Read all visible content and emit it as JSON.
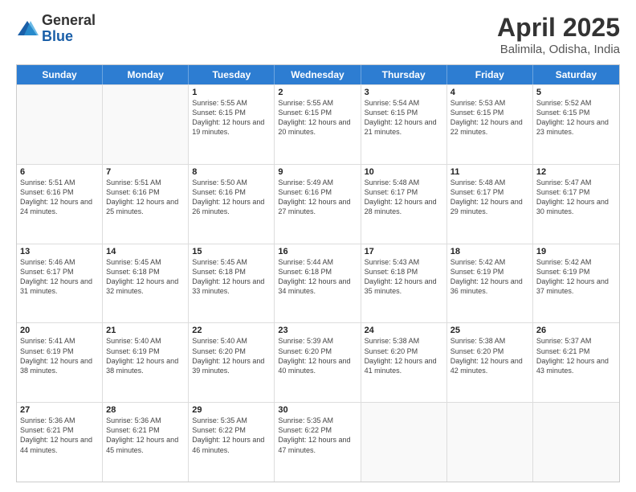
{
  "logo": {
    "general": "General",
    "blue": "Blue"
  },
  "title": {
    "month": "April 2025",
    "location": "Balimila, Odisha, India"
  },
  "header_days": [
    "Sunday",
    "Monday",
    "Tuesday",
    "Wednesday",
    "Thursday",
    "Friday",
    "Saturday"
  ],
  "weeks": [
    [
      {
        "day": "",
        "info": ""
      },
      {
        "day": "",
        "info": ""
      },
      {
        "day": "1",
        "info": "Sunrise: 5:55 AM\nSunset: 6:15 PM\nDaylight: 12 hours and 19 minutes."
      },
      {
        "day": "2",
        "info": "Sunrise: 5:55 AM\nSunset: 6:15 PM\nDaylight: 12 hours and 20 minutes."
      },
      {
        "day": "3",
        "info": "Sunrise: 5:54 AM\nSunset: 6:15 PM\nDaylight: 12 hours and 21 minutes."
      },
      {
        "day": "4",
        "info": "Sunrise: 5:53 AM\nSunset: 6:15 PM\nDaylight: 12 hours and 22 minutes."
      },
      {
        "day": "5",
        "info": "Sunrise: 5:52 AM\nSunset: 6:15 PM\nDaylight: 12 hours and 23 minutes."
      }
    ],
    [
      {
        "day": "6",
        "info": "Sunrise: 5:51 AM\nSunset: 6:16 PM\nDaylight: 12 hours and 24 minutes."
      },
      {
        "day": "7",
        "info": "Sunrise: 5:51 AM\nSunset: 6:16 PM\nDaylight: 12 hours and 25 minutes."
      },
      {
        "day": "8",
        "info": "Sunrise: 5:50 AM\nSunset: 6:16 PM\nDaylight: 12 hours and 26 minutes."
      },
      {
        "day": "9",
        "info": "Sunrise: 5:49 AM\nSunset: 6:16 PM\nDaylight: 12 hours and 27 minutes."
      },
      {
        "day": "10",
        "info": "Sunrise: 5:48 AM\nSunset: 6:17 PM\nDaylight: 12 hours and 28 minutes."
      },
      {
        "day": "11",
        "info": "Sunrise: 5:48 AM\nSunset: 6:17 PM\nDaylight: 12 hours and 29 minutes."
      },
      {
        "day": "12",
        "info": "Sunrise: 5:47 AM\nSunset: 6:17 PM\nDaylight: 12 hours and 30 minutes."
      }
    ],
    [
      {
        "day": "13",
        "info": "Sunrise: 5:46 AM\nSunset: 6:17 PM\nDaylight: 12 hours and 31 minutes."
      },
      {
        "day": "14",
        "info": "Sunrise: 5:45 AM\nSunset: 6:18 PM\nDaylight: 12 hours and 32 minutes."
      },
      {
        "day": "15",
        "info": "Sunrise: 5:45 AM\nSunset: 6:18 PM\nDaylight: 12 hours and 33 minutes."
      },
      {
        "day": "16",
        "info": "Sunrise: 5:44 AM\nSunset: 6:18 PM\nDaylight: 12 hours and 34 minutes."
      },
      {
        "day": "17",
        "info": "Sunrise: 5:43 AM\nSunset: 6:18 PM\nDaylight: 12 hours and 35 minutes."
      },
      {
        "day": "18",
        "info": "Sunrise: 5:42 AM\nSunset: 6:19 PM\nDaylight: 12 hours and 36 minutes."
      },
      {
        "day": "19",
        "info": "Sunrise: 5:42 AM\nSunset: 6:19 PM\nDaylight: 12 hours and 37 minutes."
      }
    ],
    [
      {
        "day": "20",
        "info": "Sunrise: 5:41 AM\nSunset: 6:19 PM\nDaylight: 12 hours and 38 minutes."
      },
      {
        "day": "21",
        "info": "Sunrise: 5:40 AM\nSunset: 6:19 PM\nDaylight: 12 hours and 38 minutes."
      },
      {
        "day": "22",
        "info": "Sunrise: 5:40 AM\nSunset: 6:20 PM\nDaylight: 12 hours and 39 minutes."
      },
      {
        "day": "23",
        "info": "Sunrise: 5:39 AM\nSunset: 6:20 PM\nDaylight: 12 hours and 40 minutes."
      },
      {
        "day": "24",
        "info": "Sunrise: 5:38 AM\nSunset: 6:20 PM\nDaylight: 12 hours and 41 minutes."
      },
      {
        "day": "25",
        "info": "Sunrise: 5:38 AM\nSunset: 6:20 PM\nDaylight: 12 hours and 42 minutes."
      },
      {
        "day": "26",
        "info": "Sunrise: 5:37 AM\nSunset: 6:21 PM\nDaylight: 12 hours and 43 minutes."
      }
    ],
    [
      {
        "day": "27",
        "info": "Sunrise: 5:36 AM\nSunset: 6:21 PM\nDaylight: 12 hours and 44 minutes."
      },
      {
        "day": "28",
        "info": "Sunrise: 5:36 AM\nSunset: 6:21 PM\nDaylight: 12 hours and 45 minutes."
      },
      {
        "day": "29",
        "info": "Sunrise: 5:35 AM\nSunset: 6:22 PM\nDaylight: 12 hours and 46 minutes."
      },
      {
        "day": "30",
        "info": "Sunrise: 5:35 AM\nSunset: 6:22 PM\nDaylight: 12 hours and 47 minutes."
      },
      {
        "day": "",
        "info": ""
      },
      {
        "day": "",
        "info": ""
      },
      {
        "day": "",
        "info": ""
      }
    ]
  ]
}
